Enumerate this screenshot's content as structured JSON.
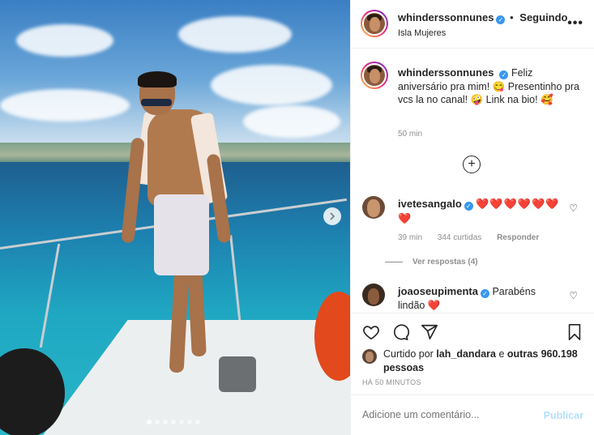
{
  "post": {
    "username": "whinderssonnunes",
    "follow_state": "Seguindo",
    "location": "Isla Mujeres",
    "more_icon": "more-icon"
  },
  "caption": {
    "username": "whinderssonnunes",
    "text": "Feliz aniversário pra mim! 😋 Presentinho pra vcs la no canal! 🤪 Link na bio! 🥰",
    "time": "50 min"
  },
  "comments": [
    {
      "username": "ivetesangalo",
      "text": "❤️❤️❤️❤️❤️❤️❤️",
      "time": "39 min",
      "likes": "344 curtidas",
      "reply": "Responder",
      "view_replies": "Ver respostas (4)"
    },
    {
      "username": "joaoseupimenta",
      "text": "Parabéns lindão ❤️"
    }
  ],
  "likes": {
    "prefix": "Curtido por",
    "user": "lah_dandara",
    "connector": "e",
    "others": "outras 960.198 pessoas"
  },
  "posted_ago": "HÁ 50 MINUTOS",
  "comment_box": {
    "placeholder": "Adicione um comentário...",
    "post_label": "Publicar"
  },
  "carousel": {
    "total": 7,
    "active": 1
  },
  "colors": {
    "link": "#3897f0",
    "heart": "#ed4956",
    "post_disabled": "#b2dffc"
  }
}
